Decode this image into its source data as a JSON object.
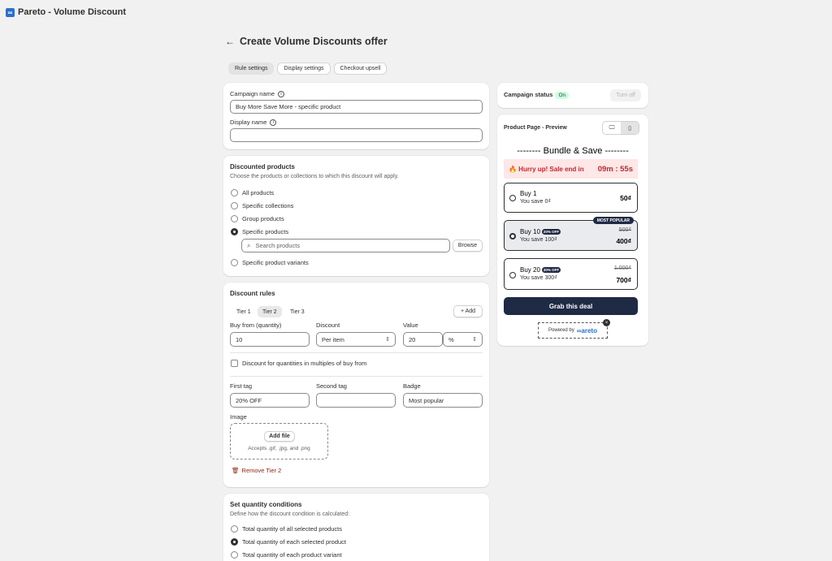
{
  "app": {
    "logo_glyph": "∞",
    "title": "Pareto - Volume Discount"
  },
  "header": {
    "back_icon": "←",
    "title": "Create Volume Discounts offer"
  },
  "tabs": [
    {
      "label": "Rule settings",
      "active": true
    },
    {
      "label": "Display settings",
      "active": false
    },
    {
      "label": "Checkout upsell",
      "active": false
    }
  ],
  "campaign": {
    "name_label": "Campaign name",
    "name_value": "Buy More Save More - specific product",
    "display_label": "Display name",
    "display_value": ""
  },
  "discounted_products": {
    "title": "Discounted products",
    "description": "Choose the products or collections to which this discount will apply.",
    "options": [
      {
        "label": "All products",
        "selected": false
      },
      {
        "label": "Specific collections",
        "selected": false
      },
      {
        "label": "Group products",
        "selected": false
      },
      {
        "label": "Specific products",
        "selected": true
      },
      {
        "label": "Specific product variants",
        "selected": false
      }
    ],
    "search_placeholder": "Search products",
    "browse_label": "Browse"
  },
  "discount_rules": {
    "title": "Discount rules",
    "tiers": [
      "Tier 1",
      "Tier 2",
      "Tier 3"
    ],
    "active_tier": "Tier 2",
    "add_label": "+ Add",
    "buy_from_label": "Buy from (quantity)",
    "buy_from_value": "10",
    "discount_label": "Discount",
    "discount_value": "Per item",
    "value_label": "Value",
    "value_value": "20",
    "unit_value": "%",
    "multiples_label": "Discount for quantities in multiples of buy from",
    "first_tag_label": "First tag",
    "first_tag_value": "20% OFF",
    "second_tag_label": "Second tag",
    "second_tag_value": "",
    "badge_label": "Badge",
    "badge_value": "Most popular",
    "image_label": "Image",
    "add_file_label": "Add file",
    "accepts_text": "Accepts .gif, .jpg, and .png",
    "remove_label": "Remove Tier 2"
  },
  "quantity_conditions": {
    "title": "Set quantity conditions",
    "description": "Define how the discount condition is calculated:",
    "options": [
      {
        "label": "Total quantity of all selected products",
        "selected": false
      },
      {
        "label": "Total quantity of each selected product",
        "selected": true
      },
      {
        "label": "Total quantity of each product variant",
        "selected": false
      }
    ]
  },
  "status": {
    "label": "Campaign status",
    "badge": "On",
    "turn_off_label": "Turn off"
  },
  "preview": {
    "label": "Product Page - Preview",
    "bundle_title": "-------- Bundle & Save --------",
    "hurry_text": "🔥 Hurry up! Sale end in",
    "timer": "09m : 55s",
    "tiers": [
      {
        "name": "Buy 1",
        "pill": "",
        "save": "You save 0₫",
        "price": "50₫",
        "old_price": "",
        "badge": ""
      },
      {
        "name": "Buy 10",
        "pill": "20% OFF",
        "save": "You save 100₫",
        "price": "400₫",
        "old_price": "500₫",
        "badge": "MOST POPULAR"
      },
      {
        "name": "Buy 20",
        "pill": "30% OFF",
        "save": "You save 300₫",
        "price": "700₫",
        "old_price": "1.000₫",
        "badge": ""
      }
    ],
    "grab_label": "Grab this deal",
    "powered_by": "Powered by",
    "brand": "∞areto"
  },
  "colors": {
    "accent_dark": "#1f2a44",
    "status_green": "#cdfee1",
    "danger": "#c1272d"
  }
}
